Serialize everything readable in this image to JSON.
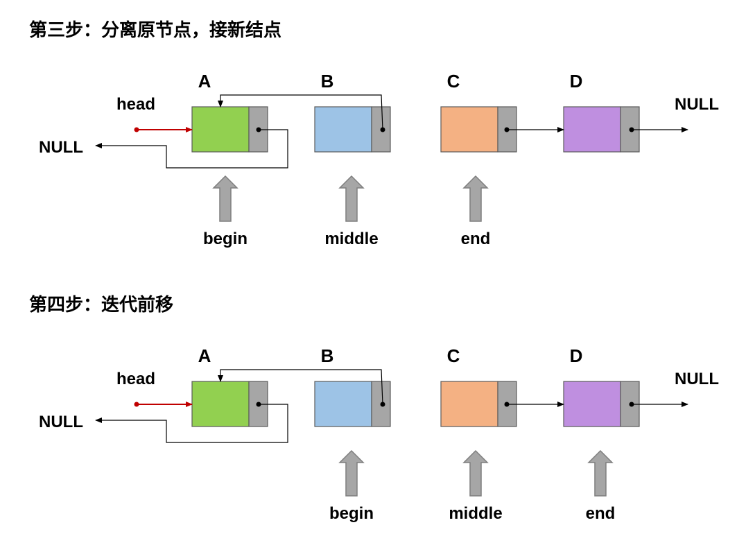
{
  "diagram": {
    "labels": {
      "head": "head",
      "null": "NULL"
    },
    "colors": {
      "A": "#92d050",
      "B": "#9dc3e6",
      "C": "#f4b183",
      "D": "#bf8fe0",
      "pointer_cell": "#a6a6a6",
      "head_arrow": "#c00000"
    },
    "steps": [
      {
        "title": "第三步：分离原节点，接新结点",
        "nodes": [
          "A",
          "B",
          "C",
          "D"
        ],
        "pointers": [
          {
            "name": "begin",
            "at": "A"
          },
          {
            "name": "middle",
            "at": "B"
          },
          {
            "name": "end",
            "at": "C"
          }
        ]
      },
      {
        "title": "第四步：迭代前移",
        "nodes": [
          "A",
          "B",
          "C",
          "D"
        ],
        "pointers": [
          {
            "name": "begin",
            "at": "B"
          },
          {
            "name": "middle",
            "at": "C"
          },
          {
            "name": "end",
            "at": "D"
          }
        ]
      }
    ]
  }
}
